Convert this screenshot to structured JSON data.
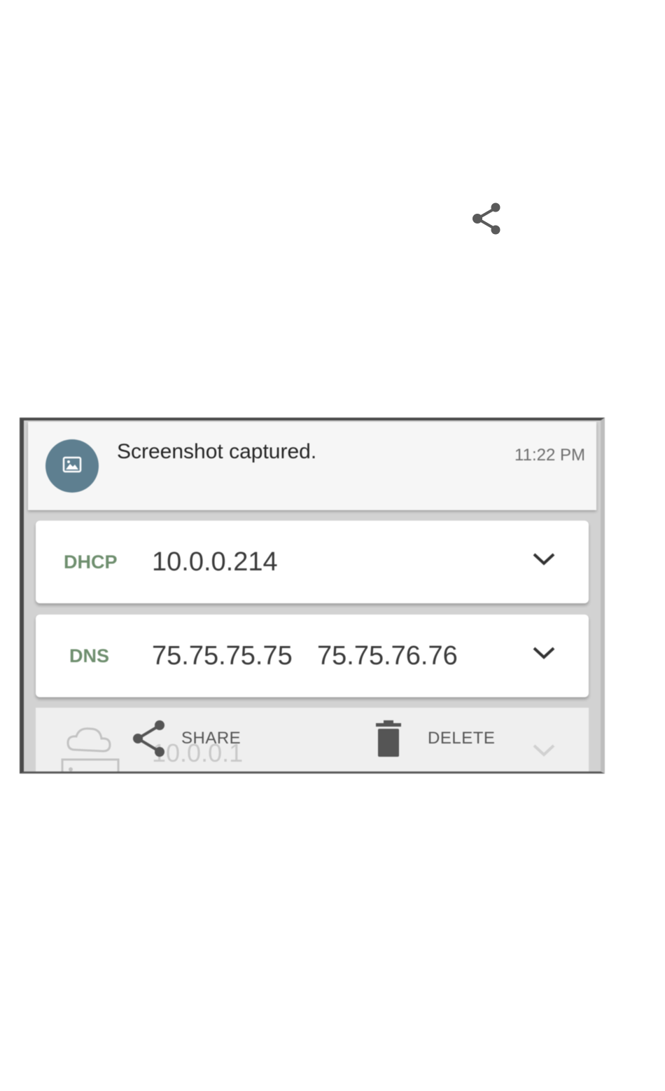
{
  "top_share": {
    "icon": "share-icon"
  },
  "notification": {
    "icon": "image-icon",
    "title": "Screenshot captured.",
    "time": "11:22 PM"
  },
  "rows": [
    {
      "label": "DHCP",
      "value": "10.0.0.214",
      "icon": "chevron-down-icon"
    },
    {
      "label": "DNS",
      "value": "75.75.75.75",
      "value2": "75.75.76.76",
      "icon": "chevron-down-icon"
    }
  ],
  "ghost_row": {
    "value": "10.0.0.1",
    "icon": "cloud-router-icon"
  },
  "actions": {
    "share_label": "SHARE",
    "delete_label": "DELETE"
  },
  "colors": {
    "label_green": "#6f8f6f",
    "avatar_bg": "#5e7f90"
  }
}
